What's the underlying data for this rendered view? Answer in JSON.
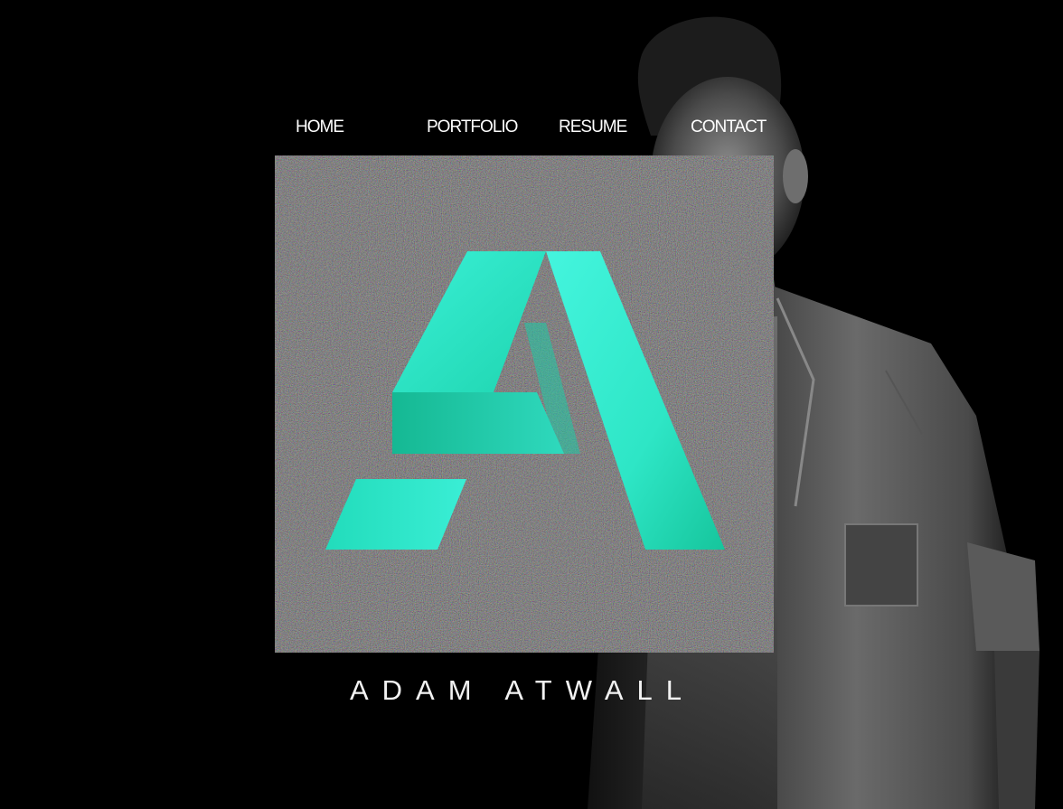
{
  "nav": {
    "items": [
      {
        "label": "HOME"
      },
      {
        "label": "PORTFOLIO"
      },
      {
        "label": "RESUME"
      },
      {
        "label": "CONTACT"
      }
    ]
  },
  "logo": {
    "letter": "A",
    "accent_color": "#2ee6c6"
  },
  "name": "ADAM ATWALL",
  "colors": {
    "background": "#000000",
    "text": "#ffffff",
    "accent": "#2ee6c6"
  }
}
